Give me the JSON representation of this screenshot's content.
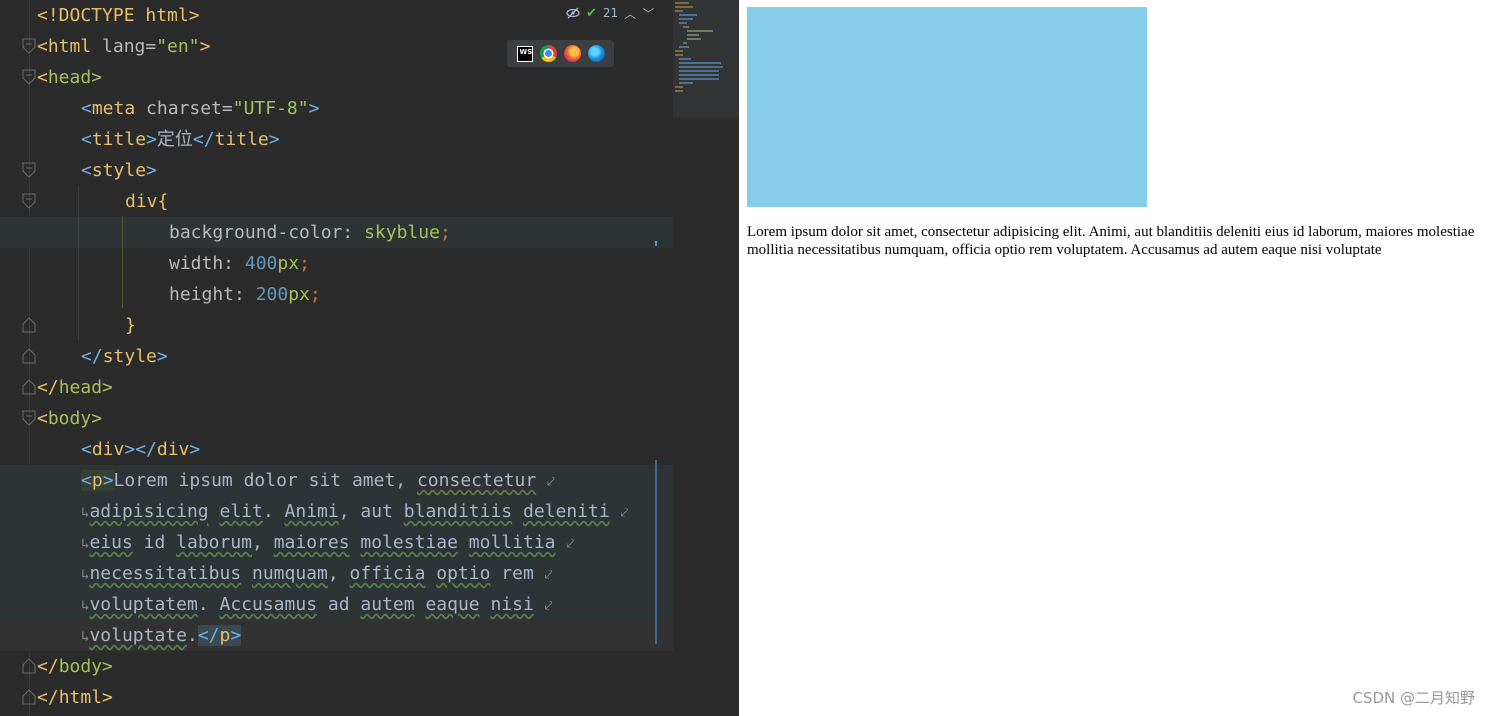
{
  "editor": {
    "inspection_count": "21",
    "lines": {
      "l1": "<!DOCTYPE html>",
      "l2_open": "<html",
      "l2_attr": " lang=",
      "l2_val": "\"en\"",
      "l2_close": ">",
      "l3_open": "<",
      "l3_name": "head",
      "l3_close": ">",
      "l4_open": "<",
      "l4_name": "meta",
      "l4_attr": " charset=",
      "l4_val": "\"UTF-8\"",
      "l4_close": ">",
      "l5_open": "<",
      "l5_name": "title",
      "l5_close": ">",
      "l5_text": "定位",
      "l5_end_open": "</",
      "l5_end_name": "title",
      "l5_end_close": ">",
      "l6_open": "<",
      "l6_name": "style",
      "l6_close": ">",
      "l7_sel": "div",
      "l7_brace": "{",
      "l8_prop": "background-color: ",
      "l8_val": "skyblue",
      "l8_semi": ";",
      "l9_prop": "width: ",
      "l9_num": "400",
      "l9_unit": "px",
      "l9_semi": ";",
      "l10_prop": "height: ",
      "l10_num": "200",
      "l10_unit": "px",
      "l10_semi": ";",
      "l11_brace": "}",
      "l12_open": "</",
      "l12_name": "style",
      "l12_close": ">",
      "l13_open": "</",
      "l13_name": "head",
      "l13_close": ">",
      "l14_open": "<",
      "l14_name": "body",
      "l14_close": ">",
      "l15_a": "<",
      "l15_b": "div",
      "l15_c": "></",
      "l15_d": "div",
      "l15_e": ">",
      "l16_open": "<",
      "l16_name": "p",
      "l16_close": ">",
      "l16_text_a": "Lorem ipsum dolor sit amet, ",
      "l16_text_b": "consectetur",
      "l17_a": "adipisicing",
      "l17_b": " ",
      "l17_c": "elit",
      "l17_d": ". ",
      "l17_e": "Animi",
      "l17_f": ", aut ",
      "l17_g": "blanditiis",
      "l17_h": " ",
      "l17_i": "deleniti",
      "l18_a": "eius",
      "l18_b": " id ",
      "l18_c": "laborum",
      "l18_d": ", ",
      "l18_e": "maiores",
      "l18_f": " ",
      "l18_g": "molestiae",
      "l18_h": " ",
      "l18_i": "mollitia",
      "l19_a": "necessitatibus",
      "l19_b": " ",
      "l19_c": "numquam",
      "l19_d": ", ",
      "l19_e": "officia",
      "l19_f": " ",
      "l19_g": "optio",
      "l19_h": " rem",
      "l20_a": "voluptatem",
      "l20_b": ". ",
      "l20_c": "Accusamus",
      "l20_d": " ad ",
      "l20_e": "autem",
      "l20_f": " ",
      "l20_g": "eaque",
      "l20_h": " ",
      "l20_i": "nisi",
      "l21_a": "voluptate",
      "l21_b": ".",
      "l21_c": "</",
      "l21_d": "p",
      "l21_e": ">",
      "l22_open": "</",
      "l22_name": "body",
      "l22_close": ">",
      "l23_open": "</",
      "l23_name": "html",
      "l23_close": ">"
    }
  },
  "icons": {
    "inspections": "eye-crossed-icon",
    "check": "check-icon",
    "prev": "chevron-up-icon",
    "next": "chevron-down-icon",
    "browsers": [
      "webstorm-icon",
      "chrome-icon",
      "firefox-icon",
      "edge-icon"
    ],
    "ws_text": "WS"
  },
  "preview": {
    "box_color": "#87ceeb",
    "paragraph": "Lorem ipsum dolor sit amet, consectetur adipisicing elit. Animi, aut blanditiis deleniti eius id laborum, maiores molestiae mollitia necessitatibus numquam, officia optio rem voluptatem. Accusamus ad autem eaque nisi voluptate",
    "watermark": "CSDN @二月知野"
  }
}
